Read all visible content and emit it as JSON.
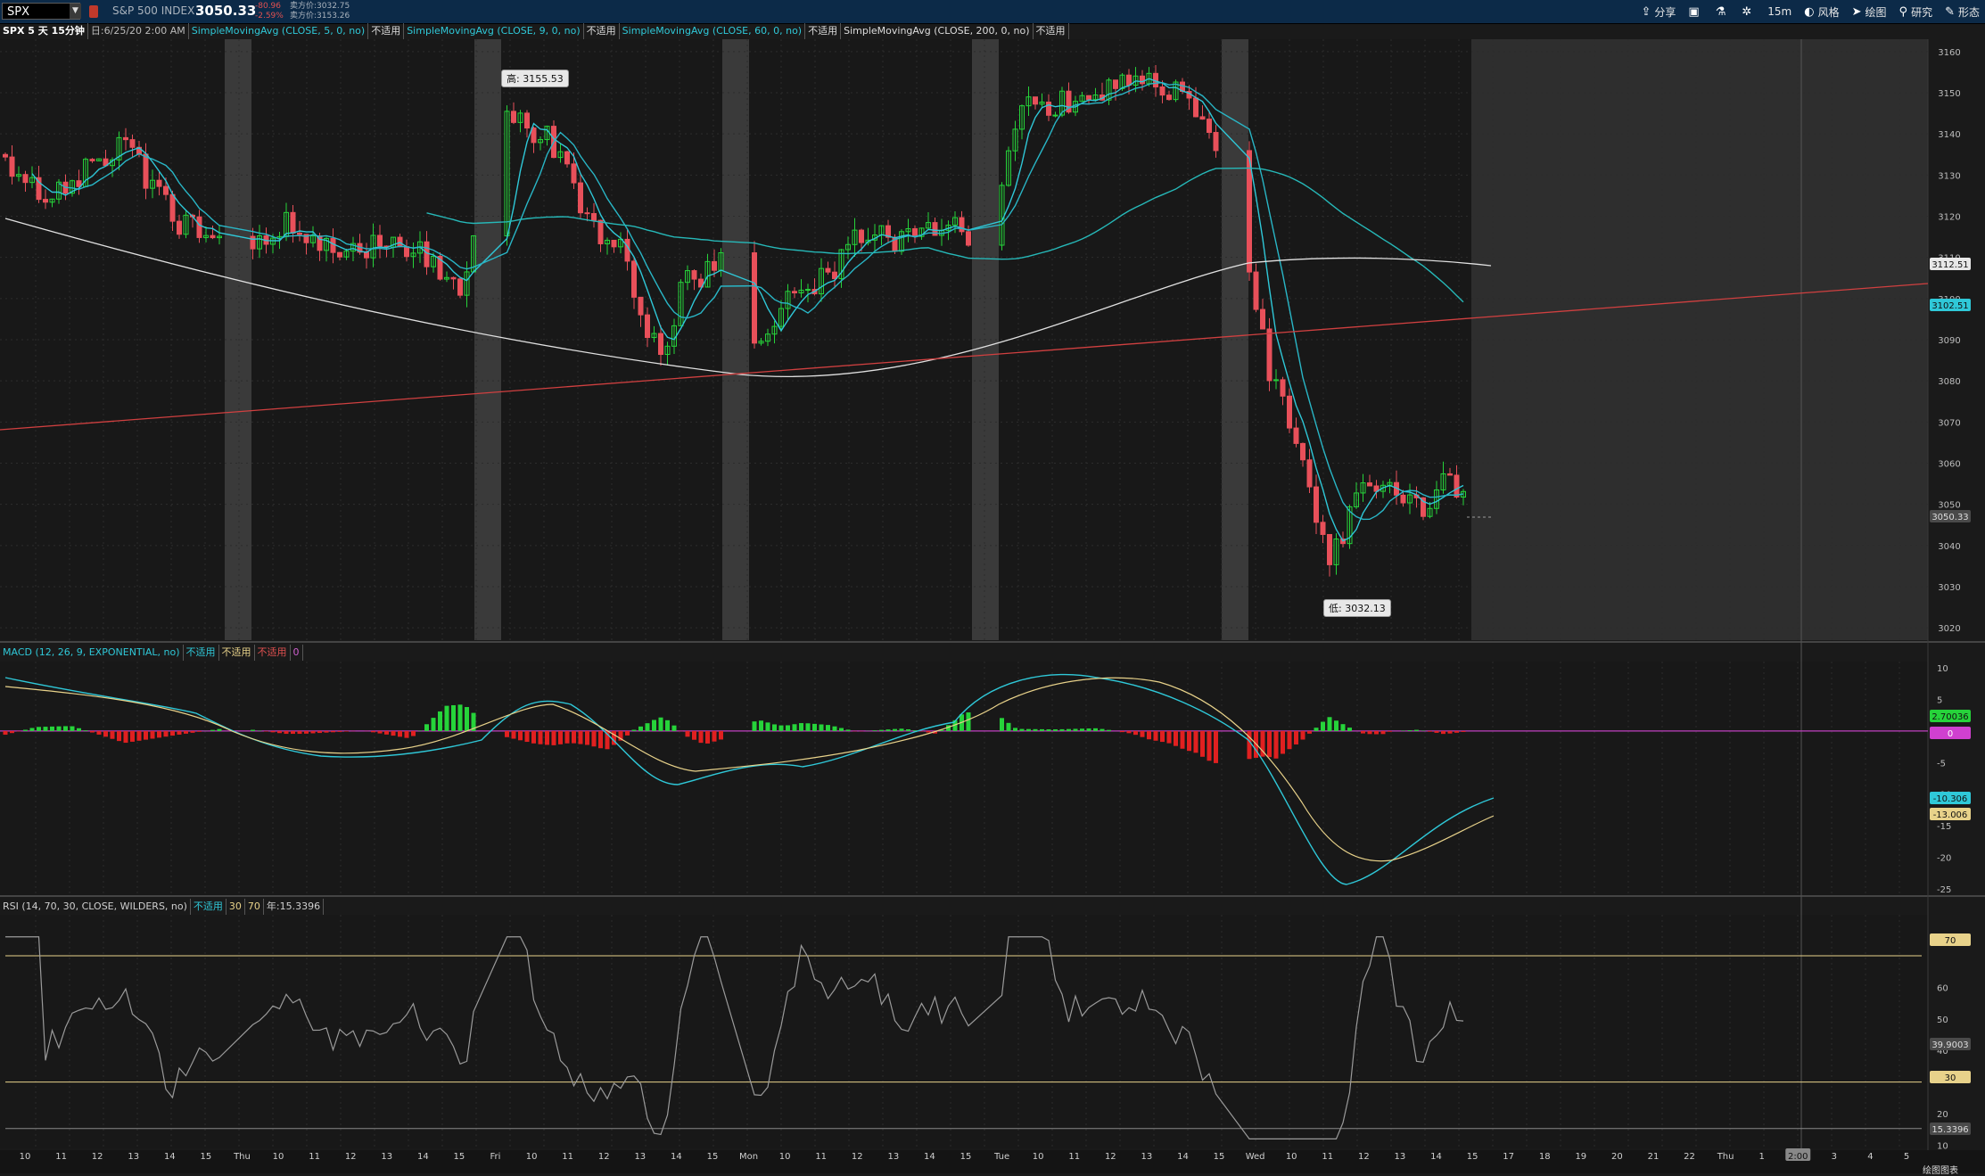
{
  "topbar": {
    "symbol": "SPX",
    "symbol_name": "S&P 500 INDEX",
    "last": "3050.33",
    "change": "-80.96",
    "change_pct": "-2.59%",
    "bid": "卖方价:3032.75",
    "ask": "卖方价:3153.26",
    "tools": [
      {
        "icon": "share-icon",
        "label": "分享"
      },
      {
        "icon": "compare-icon",
        "label": ""
      },
      {
        "icon": "flask-icon",
        "label": ""
      },
      {
        "icon": "gear-icon",
        "label": ""
      },
      {
        "icon": "",
        "label": "15m"
      },
      {
        "icon": "style-icon",
        "label": "风格"
      },
      {
        "icon": "cursor-icon",
        "label": "绘图"
      },
      {
        "icon": "study-icon",
        "label": "研究"
      },
      {
        "icon": "pattern-icon",
        "label": "形态"
      }
    ]
  },
  "studybar": {
    "symbol_period": "SPX 5 天 15分钟",
    "date": "日:6/25/20 2:00 AM",
    "studies": [
      {
        "label": "SimpleMovingAvg (CLOSE, 5, 0, no)",
        "na": "不适用",
        "color": "cyan"
      },
      {
        "label": "SimpleMovingAvg (CLOSE, 9, 0, no)",
        "na": "不适用",
        "color": "cyan"
      },
      {
        "label": "SimpleMovingAvg (CLOSE, 60, 0, no)",
        "na": "不适用",
        "color": "cyan"
      },
      {
        "label": "SimpleMovingAvg (CLOSE, 200, 0, no)",
        "na": "不适用",
        "color": "white"
      }
    ]
  },
  "bubbles": {
    "high": "高: 3155.53",
    "low": "低: 3032.13"
  },
  "price_axis": {
    "ticks": [
      "3160",
      "3150",
      "3140",
      "3130",
      "3120",
      "3110",
      "3100",
      "3090",
      "3080",
      "3070",
      "3060",
      "3050",
      "3040",
      "3030",
      "3020"
    ],
    "labels": [
      {
        "text": "3112.51",
        "kind": "white"
      },
      {
        "text": "3102.51",
        "kind": "cyan"
      },
      {
        "text": "3050.33",
        "kind": "gray"
      }
    ]
  },
  "macd": {
    "header": "MACD (12, 26, 9, EXPONENTIAL, no)",
    "na1": "不适用",
    "na2": "不适用",
    "na3": "不适用",
    "zero": "0",
    "ticks": [
      "10",
      "5",
      "0",
      "-5",
      "-10",
      "-15",
      "-20",
      "-25"
    ],
    "labels": [
      {
        "text": "2.70036",
        "kind": "green"
      },
      {
        "text": "0",
        "kind": "magenta"
      },
      {
        "text": "-10.306",
        "kind": "cyan"
      },
      {
        "text": "-13.006",
        "kind": "yellow"
      }
    ]
  },
  "rsi": {
    "header": "RSI (14, 70, 30, CLOSE, WILDERS, no)",
    "na": "不适用",
    "ob": "30",
    "os": "70",
    "value": "年:15.3396",
    "ticks": [
      "60",
      "50",
      "40",
      "20",
      "10"
    ],
    "labels": [
      {
        "text": "70",
        "kind": "yellow"
      },
      {
        "text": "39.9003",
        "kind": "gray"
      },
      {
        "text": "30",
        "kind": "yellow"
      },
      {
        "text": "15.3396",
        "kind": "gray"
      }
    ]
  },
  "time_axis": [
    "10",
    "11",
    "12",
    "13",
    "14",
    "15",
    "Thu",
    "10",
    "11",
    "12",
    "13",
    "14",
    "15",
    "Fri",
    "10",
    "11",
    "12",
    "13",
    "14",
    "15",
    "Mon",
    "10",
    "11",
    "12",
    "13",
    "14",
    "15",
    "Tue",
    "10",
    "11",
    "12",
    "13",
    "14",
    "15",
    "Wed",
    "10",
    "11",
    "12",
    "13",
    "14",
    "15",
    "17",
    "18",
    "19",
    "20",
    "21",
    "22",
    "Thu",
    "1",
    "2:00",
    "3",
    "4",
    "5"
  ],
  "footer": "绘图图表"
}
